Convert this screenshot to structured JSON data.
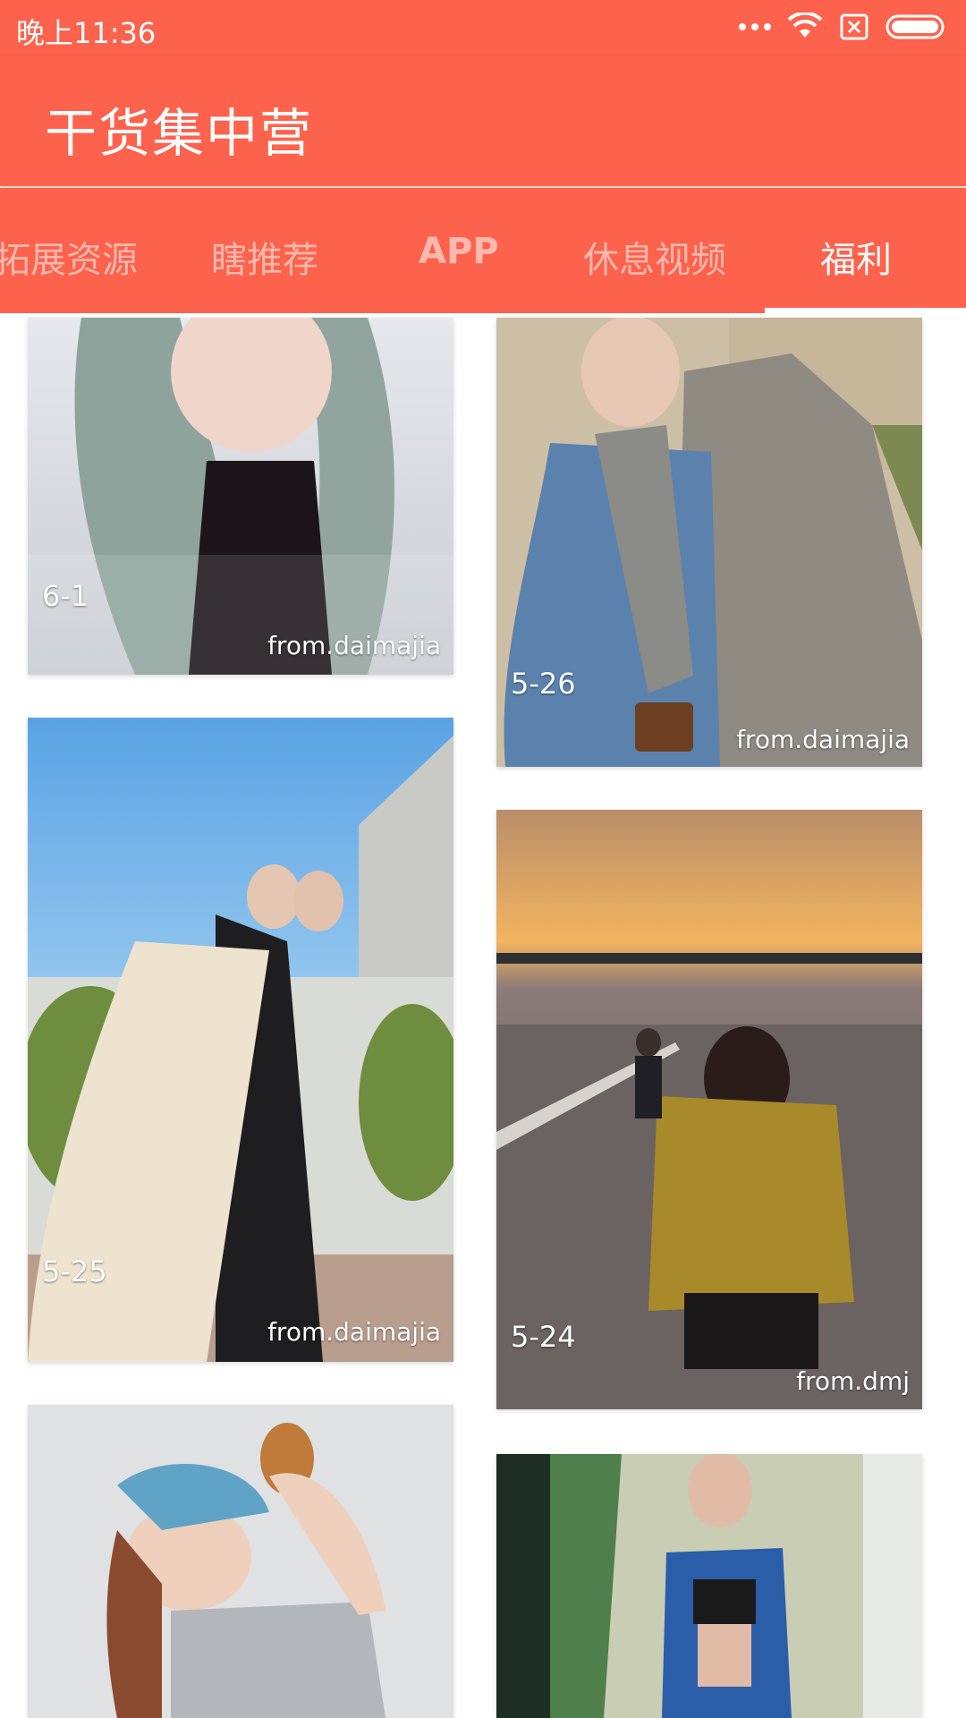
{
  "status_bar": {
    "time": "晚上11:36",
    "icons": [
      "more-dots-icon",
      "wifi-icon",
      "sim-card-icon",
      "battery-icon"
    ]
  },
  "app_bar": {
    "title": "干货集中营",
    "color": "#fd624c"
  },
  "tabs": [
    {
      "label": "拓展资源",
      "active": false
    },
    {
      "label": "瞎推荐",
      "active": false
    },
    {
      "label": "APP",
      "active": false
    },
    {
      "label": "休息视频",
      "active": false
    },
    {
      "label": "福利",
      "active": true
    }
  ],
  "feed": {
    "items": [
      {
        "date": "6-1",
        "source": "from.daimajia"
      },
      {
        "date": "5-26",
        "source": "from.daimajia"
      },
      {
        "date": "5-25",
        "source": "from.daimajia"
      },
      {
        "date": "5-24",
        "source": "from.dmj"
      },
      {
        "date": "",
        "source": ""
      },
      {
        "date": "",
        "source": ""
      }
    ]
  }
}
